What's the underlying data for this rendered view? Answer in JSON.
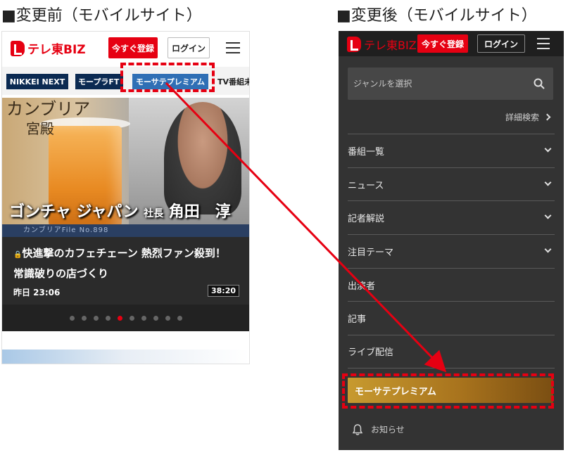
{
  "captions": {
    "before": "■変更前（モバイルサイト）",
    "after": "■変更後（モバイルサイト）"
  },
  "brand": {
    "name": "テレ東BIZ",
    "accent": "#e60012"
  },
  "header": {
    "register_label": "今すぐ登録",
    "login_label": "ログイン"
  },
  "before": {
    "tabs": [
      {
        "label": "NIKKEI NEXT"
      },
      {
        "label": "モープラFT"
      },
      {
        "label": "モーサテプレミアム"
      },
      {
        "label": "TV番組未"
      }
    ],
    "hero": {
      "series_title_1": "カンブリア",
      "series_title_2": "宮殿",
      "guest_company": "ゴンチャ ジャパン",
      "guest_role": "社長",
      "guest_name": "角田　淳",
      "strip_text": "カンブリアFile No.898"
    },
    "card": {
      "title": "快進撃のカフェチェーン 熱烈ファン殺到！常識破りの店づくり",
      "time": "昨日  23:06",
      "duration": "38:20"
    },
    "carousel": {
      "count": 10,
      "active_index": 4
    }
  },
  "after": {
    "genre_placeholder": "ジャンルを選択",
    "detail_search_label": "詳細検索",
    "menu": [
      {
        "label": "番組一覧",
        "expandable": true
      },
      {
        "label": "ニュース",
        "expandable": true
      },
      {
        "label": "記者解説",
        "expandable": true
      },
      {
        "label": "注目テーマ",
        "expandable": true
      },
      {
        "label": "出演者",
        "expandable": false
      },
      {
        "label": "記事",
        "expandable": false
      },
      {
        "label": "ライブ配信",
        "expandable": false
      }
    ],
    "premium_label": "モーサテプレミアム",
    "notice_label": "お知らせ"
  },
  "colors": {
    "annotation": "#e60012",
    "panel_dark": "#333333",
    "premium_gold": "#c79a2f"
  }
}
